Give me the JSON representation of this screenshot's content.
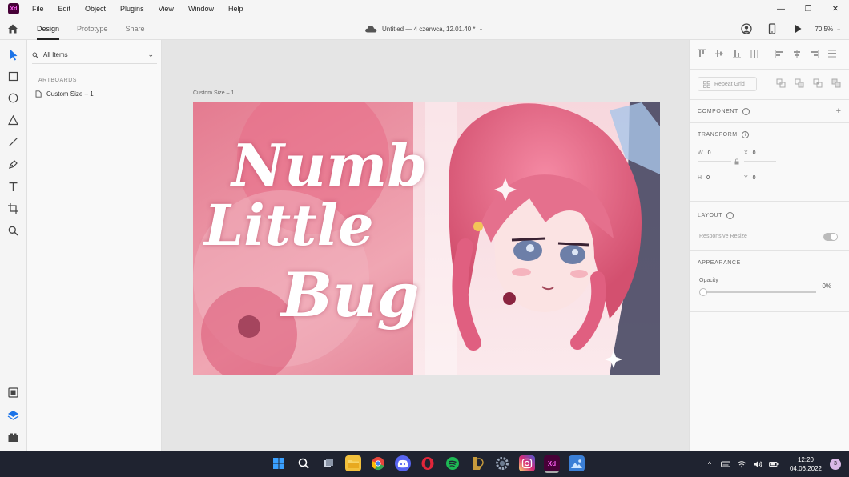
{
  "app": {
    "logo_text": "Xd",
    "accent": "#470137",
    "accent_text": "#ff61f6"
  },
  "menu": [
    "File",
    "Edit",
    "Object",
    "Plugins",
    "View",
    "Window",
    "Help"
  ],
  "window_controls": {
    "minimize": "—",
    "maximize": "❐",
    "close": "✕"
  },
  "tabs": [
    {
      "label": "Design",
      "active": true
    },
    {
      "label": "Prototype",
      "active": false
    },
    {
      "label": "Share",
      "active": false
    }
  ],
  "document": {
    "title": "Untitled — 4 czerwca, 12.01.40 *"
  },
  "toolbar_right": {
    "zoom": "70.5%"
  },
  "tools": [
    "select-tool",
    "rectangle-tool",
    "ellipse-tool",
    "polygon-tool",
    "line-tool",
    "pen-tool",
    "text-tool",
    "artboard-tool",
    "zoom-tool"
  ],
  "layers": {
    "filter_label": "All Items",
    "section_heading": "ARTBOARDS",
    "artboards": [
      "Custom Size – 1"
    ]
  },
  "canvas": {
    "artboard_label": "Custom Size – 1",
    "artwork_text": [
      "Numb",
      "Little",
      "Bug"
    ],
    "artwork_colors": {
      "pink_light": "#f3b9c0",
      "pink_deep": "#e5788f",
      "hair": "#e96b8a",
      "eye": "#6d7fa8"
    }
  },
  "inspector": {
    "repeat_grid": "Repeat Grid",
    "component": "COMPONENT",
    "transform": "TRANSFORM",
    "w_label": "W",
    "w_value": "0",
    "h_label": "H",
    "h_value": "0",
    "x_label": "X",
    "x_value": "0",
    "y_label": "Y",
    "y_value": "0",
    "layout": "LAYOUT",
    "responsive_resize": "Responsive Resize",
    "appearance": "APPEARANCE",
    "opacity_label": "Opacity",
    "opacity_value": "0%"
  },
  "taskbar": {
    "time": "12:20",
    "date": "04.06.2022",
    "notifications": "3",
    "apps": [
      {
        "name": "windows-start",
        "color": "#3aa0ff"
      },
      {
        "name": "search",
        "color": "transparent"
      },
      {
        "name": "task-view",
        "color": "transparent"
      },
      {
        "name": "file-explorer",
        "color": "#f2c03c"
      },
      {
        "name": "chrome",
        "color": "#e8453c"
      },
      {
        "name": "discord",
        "color": "#5865f2"
      },
      {
        "name": "opera",
        "color": "#e0263a"
      },
      {
        "name": "spotify",
        "color": "#1db954"
      },
      {
        "name": "league-of-legends",
        "color": "#c89b3c"
      },
      {
        "name": "settings",
        "color": "#6b7a8f"
      },
      {
        "name": "instagram",
        "color": "#d62976"
      },
      {
        "name": "adobe-xd",
        "color": "#470137"
      },
      {
        "name": "photos",
        "color": "#3b7fd6"
      }
    ]
  }
}
